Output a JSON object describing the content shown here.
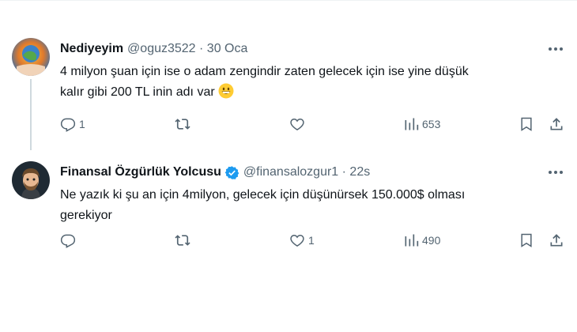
{
  "tweets": [
    {
      "name": "Nediyeyim",
      "handle": "@oguz3522 · 30 Oca",
      "line1": "4 milyon şuan için ise o adam zengindir zaten gelecek için ise yine düşük",
      "line2": "kalır gibi 200 TL inin adı var",
      "emoji": "grinning-face",
      "reply_count": "1",
      "retweet_count": "",
      "like_count": "",
      "view_count": "653"
    },
    {
      "name": "Finansal Özgürlük Yolcusu",
      "handle": "@finansalozgur1 · 22s",
      "verified_color": "#1d9bf0",
      "line1": "Ne yazık ki şu an için 4milyon, gelecek için düşünürsek 150.000$ olması",
      "line2": "gerekiyor",
      "reply_count": "",
      "retweet_count": "",
      "like_count": "1",
      "view_count": "490"
    }
  ],
  "colors": {
    "text": "#0f1419",
    "muted": "#536471",
    "accent": "#1d9bf0"
  }
}
